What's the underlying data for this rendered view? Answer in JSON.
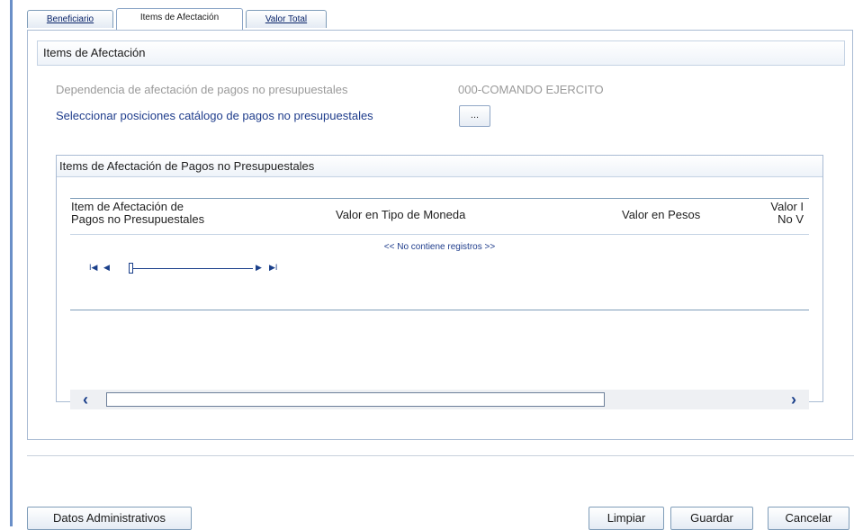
{
  "tabs": [
    {
      "label": "Beneficiario",
      "active": false
    },
    {
      "label": "Items de Afectación",
      "active": true
    },
    {
      "label": "Valor Total",
      "active": false
    }
  ],
  "section": {
    "title": "Items de Afectación"
  },
  "fields": {
    "dependencia_label": "Dependencia de afectación de pagos no presupuestales",
    "dependencia_value": "000-COMANDO EJERCITO",
    "seleccionar_label": "Seleccionar posiciones catálogo de pagos no presupuestales",
    "ellipsis_button": "..."
  },
  "grid": {
    "title": "Items de Afectación de Pagos no Presupuestales",
    "columns": [
      {
        "line1": "Item de Afectación de",
        "line2": "Pagos no Presupuestales"
      },
      {
        "line1": "Valor en Tipo de Moneda"
      },
      {
        "line1": "Valor en Pesos"
      },
      {
        "line1": "Valor I",
        "line2": "No V"
      }
    ],
    "empty_message": "<< No contiene registros >>",
    "pager": {
      "first": "I◀",
      "prev": "◀",
      "next": "▶",
      "last": "▶I"
    },
    "scroll": {
      "left": "‹",
      "right": "›"
    }
  },
  "buttons": {
    "datos_administrativos": "Datos Administrativos",
    "limpiar": "Limpiar",
    "guardar": "Guardar",
    "cancelar": "Cancelar"
  },
  "colors": {
    "accent": "#1f3d8c",
    "border": "#7f9db9",
    "left_bar": "#6a8fc8"
  }
}
